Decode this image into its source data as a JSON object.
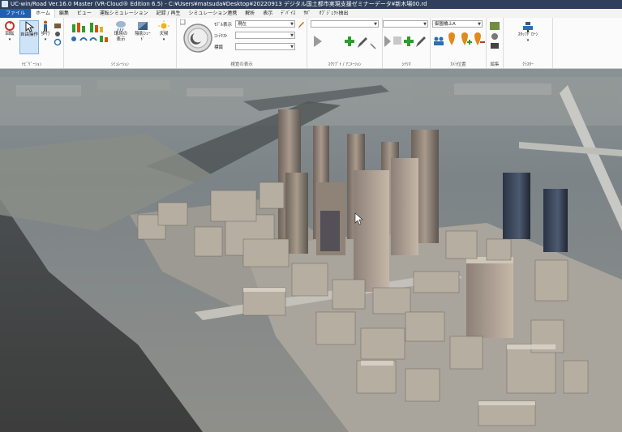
{
  "window": {
    "title": "UC-win/Road Ver.16.0 Master (VR-Cloud® Edition 6.5) - C:¥Users¥matsuda¥Desktop¥20220913 デジタル国土都市実現支援ゼミナーデータ¥新木場00.rd"
  },
  "menu": {
    "file": "ファイル",
    "items": [
      "ホーム",
      "編集",
      "ビュー",
      "運転シミュレーション",
      "記録 / 再生",
      "シミュレーション連携",
      "解析",
      "表示",
      "ﾃﾞﾊﾞｲｽ",
      "ｻﾎﾟ",
      "ｵﾌﾞｼﾞｪｸﾄ抽出"
    ]
  },
  "ribbon": {
    "navigation": {
      "group_label": "ﾅﾋﾞｹﾞｰｼｮﾝ",
      "rotate": "回転",
      "free_move": "自由操作",
      "walk": "歩行"
    },
    "simulation": {
      "group_label": "ｼﾐｭﾚｰｼｮﾝ",
      "env_display": "環境の表示",
      "shadow": "陰影ｼｪｰﾄﾞ",
      "weather": "天候"
    },
    "view_display": {
      "group_label": "視覚の表示",
      "model_label": "ﾓﾃﾞﾙ表示",
      "model_value": "現在",
      "context_label": "ｺﾝﾃｷｽﾄ",
      "context_value": "",
      "marker_label": "標識",
      "marker_value": ""
    },
    "script": {
      "group_label": "ｽｸﾘﾌﾟﾄ / ｱﾆﾒｰｼｮﾝ",
      "value": ""
    },
    "scenario": {
      "group_label": "ｼﾅﾘｵ",
      "value": ""
    },
    "camera": {
      "group_label": "ｶﾒﾗ位置",
      "value": "御園橋上A"
    },
    "edit": {
      "group_label": "編集"
    },
    "cluster": {
      "group_label": "ｸﾗｽﾀｰ",
      "start_drone": "ｽﾀｯﾌﾄﾞﾛｰﾝ"
    }
  },
  "colors": {
    "title_bg": "#2f3f5c",
    "file_tab": "#1f5fb0",
    "accent_green": "#2e9c2e",
    "accent_orange": "#e08a1e"
  }
}
